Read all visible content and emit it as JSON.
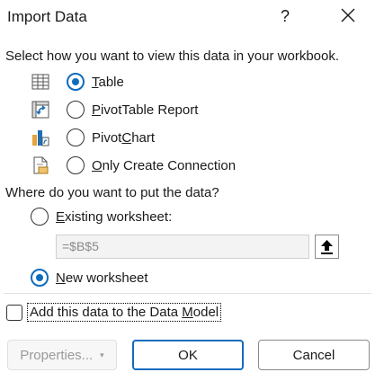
{
  "dialog": {
    "title": "Import Data",
    "help_symbol": "?"
  },
  "view_section": {
    "label": "Select how you want to view this data in your workbook.",
    "options": [
      {
        "label": "Table",
        "selected": true,
        "icon": "table-icon"
      },
      {
        "label": "PivotTable Report",
        "selected": false,
        "icon": "pivottable-icon"
      },
      {
        "label": "PivotChart",
        "selected": false,
        "icon": "pivotchart-icon"
      },
      {
        "label": "Only Create Connection",
        "selected": false,
        "icon": "connection-icon"
      }
    ]
  },
  "location_section": {
    "label": "Where do you want to put the data?",
    "existing_label": "Existing worksheet:",
    "existing_selected": false,
    "range_value": "=$B$5",
    "new_label": "New worksheet",
    "new_selected": true
  },
  "data_model": {
    "label": "Add this data to the Data Model",
    "checked": false
  },
  "buttons": {
    "properties": "Properties...",
    "ok": "OK",
    "cancel": "Cancel"
  },
  "colors": {
    "accent": "#0f6cbd"
  }
}
